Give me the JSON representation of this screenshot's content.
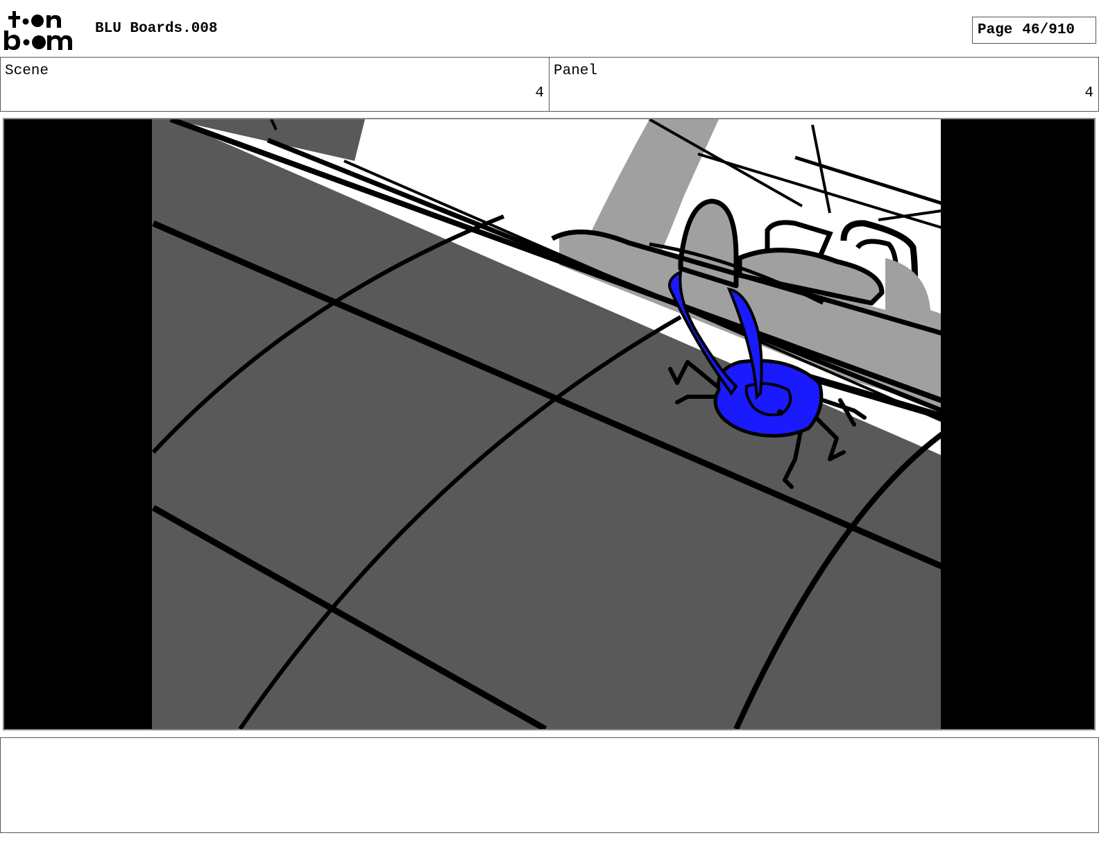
{
  "header": {
    "logo_text": "toon boom",
    "document_title": "BLU Boards.008",
    "page_label": "Page",
    "page_number": "46/910"
  },
  "info": {
    "scene_label": "Scene",
    "scene_value": "4",
    "panel_label": "Panel",
    "panel_value": "4"
  },
  "caption": {
    "text": ""
  },
  "colors": {
    "floor": "#595959",
    "wall_gray": "#a0a0a0",
    "beetle_blue": "#1a1aff",
    "letterbox": "#000000"
  }
}
